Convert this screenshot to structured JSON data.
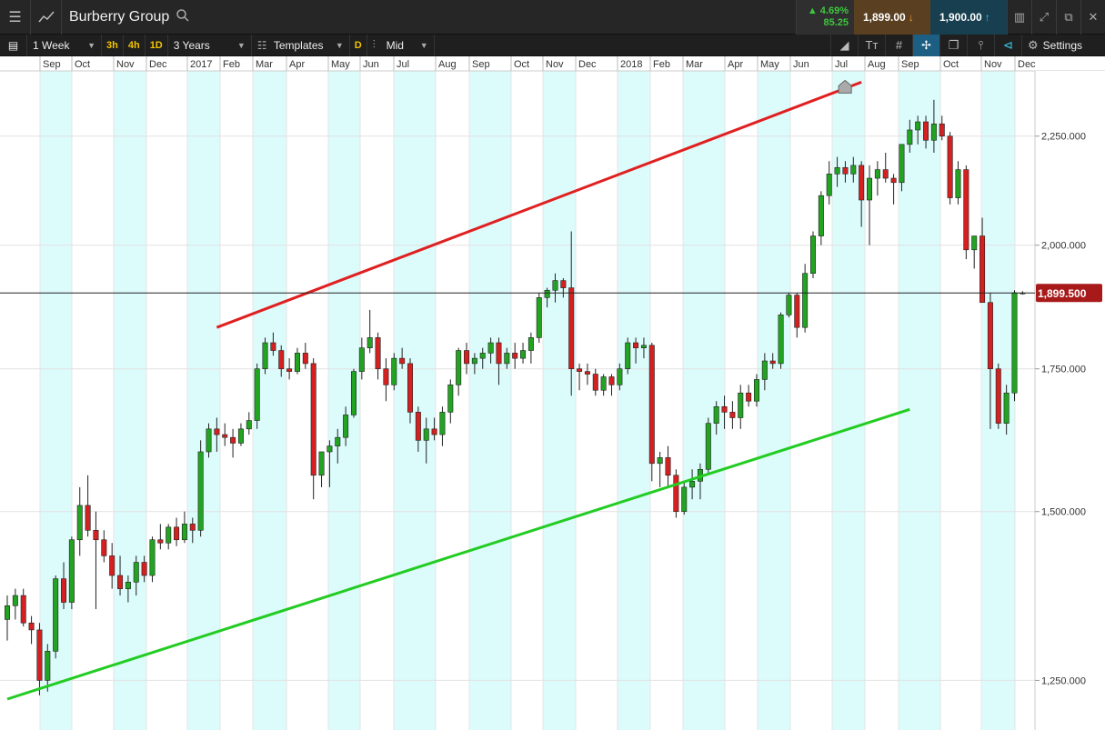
{
  "header": {
    "title": "Burberry Group",
    "change_pct": "▲ 4.69%",
    "change_abs": "85.25",
    "sell_price": "1,899.00",
    "buy_price": "1,900.00"
  },
  "toolbar": {
    "interval": "1 Week",
    "quick_intervals": [
      "3h",
      "4h",
      "1D"
    ],
    "range": "3 Years",
    "templates": "Templates",
    "d_badge": "D",
    "price_type": "Mid",
    "settings": "Settings"
  },
  "colors": {
    "up": "#22a322",
    "down": "#d42020",
    "resistance": "#e02020",
    "support": "#22cc22",
    "band": "#dcfbfb",
    "price_tag": "#a81a1a"
  },
  "chart_data": {
    "type": "candlestick",
    "x_labels": [
      "Sep",
      "Oct",
      "Nov",
      "Dec",
      "2017",
      "Feb",
      "Mar",
      "Apr",
      "May",
      "Jun",
      "Jul",
      "Aug",
      "Sep",
      "Oct",
      "Nov",
      "Dec",
      "2018",
      "Feb",
      "Mar",
      "Apr",
      "May",
      "Jun",
      "Jul",
      "Aug",
      "Sep",
      "Oct",
      "Nov",
      "Dec"
    ],
    "y_ticks": [
      "2,250.000",
      "2,000.000",
      "1,750.000",
      "1,500.000",
      "1,250.000"
    ],
    "y_tick_values": [
      2250,
      2000,
      1750,
      1500,
      1250
    ],
    "current_price": 1899.5,
    "current_price_label": "1,899.500",
    "ylim": [
      1200,
      2400
    ],
    "scale": "log",
    "trendlines": [
      {
        "name": "resistance",
        "from": [
          26,
          1830
        ],
        "to": [
          106,
          2385
        ]
      },
      {
        "name": "support",
        "from": [
          0,
          1225
        ],
        "to": [
          112,
          1675
        ]
      }
    ],
    "candles": [
      [
        1335,
        1370,
        1305,
        1355
      ],
      [
        1355,
        1380,
        1335,
        1370
      ],
      [
        1370,
        1380,
        1325,
        1330
      ],
      [
        1330,
        1340,
        1300,
        1320
      ],
      [
        1320,
        1330,
        1230,
        1250
      ],
      [
        1250,
        1300,
        1235,
        1290
      ],
      [
        1290,
        1400,
        1280,
        1395
      ],
      [
        1395,
        1420,
        1350,
        1360
      ],
      [
        1360,
        1460,
        1350,
        1455
      ],
      [
        1455,
        1540,
        1430,
        1510
      ],
      [
        1510,
        1560,
        1460,
        1470
      ],
      [
        1470,
        1500,
        1350,
        1455
      ],
      [
        1455,
        1470,
        1420,
        1430
      ],
      [
        1430,
        1450,
        1380,
        1400
      ],
      [
        1400,
        1430,
        1370,
        1380
      ],
      [
        1380,
        1400,
        1360,
        1390
      ],
      [
        1390,
        1430,
        1370,
        1420
      ],
      [
        1420,
        1430,
        1390,
        1400
      ],
      [
        1400,
        1460,
        1390,
        1455
      ],
      [
        1455,
        1480,
        1440,
        1450
      ],
      [
        1450,
        1480,
        1440,
        1475
      ],
      [
        1475,
        1490,
        1445,
        1455
      ],
      [
        1455,
        1500,
        1450,
        1480
      ],
      [
        1480,
        1490,
        1450,
        1470
      ],
      [
        1470,
        1620,
        1460,
        1600
      ],
      [
        1600,
        1650,
        1590,
        1640
      ],
      [
        1640,
        1660,
        1600,
        1630
      ],
      [
        1630,
        1650,
        1610,
        1625
      ],
      [
        1625,
        1640,
        1590,
        1615
      ],
      [
        1615,
        1650,
        1610,
        1640
      ],
      [
        1640,
        1670,
        1630,
        1655
      ],
      [
        1655,
        1760,
        1640,
        1750
      ],
      [
        1750,
        1810,
        1740,
        1800
      ],
      [
        1800,
        1820,
        1775,
        1785
      ],
      [
        1785,
        1795,
        1735,
        1750
      ],
      [
        1750,
        1770,
        1730,
        1745
      ],
      [
        1745,
        1790,
        1740,
        1780
      ],
      [
        1780,
        1800,
        1750,
        1760
      ],
      [
        1760,
        1770,
        1520,
        1560
      ],
      [
        1560,
        1600,
        1540,
        1600
      ],
      [
        1600,
        1620,
        1540,
        1610
      ],
      [
        1610,
        1640,
        1580,
        1625
      ],
      [
        1625,
        1680,
        1610,
        1665
      ],
      [
        1665,
        1750,
        1660,
        1745
      ],
      [
        1745,
        1810,
        1730,
        1790
      ],
      [
        1790,
        1865,
        1780,
        1810
      ],
      [
        1810,
        1820,
        1730,
        1750
      ],
      [
        1750,
        1770,
        1690,
        1720
      ],
      [
        1720,
        1780,
        1710,
        1770
      ],
      [
        1770,
        1790,
        1750,
        1760
      ],
      [
        1760,
        1770,
        1650,
        1670
      ],
      [
        1670,
        1680,
        1600,
        1620
      ],
      [
        1620,
        1660,
        1580,
        1640
      ],
      [
        1640,
        1660,
        1620,
        1630
      ],
      [
        1630,
        1680,
        1610,
        1670
      ],
      [
        1670,
        1730,
        1650,
        1720
      ],
      [
        1720,
        1790,
        1700,
        1785
      ],
      [
        1785,
        1800,
        1740,
        1760
      ],
      [
        1760,
        1780,
        1740,
        1770
      ],
      [
        1770,
        1790,
        1750,
        1780
      ],
      [
        1780,
        1810,
        1760,
        1800
      ],
      [
        1800,
        1810,
        1720,
        1760
      ],
      [
        1760,
        1790,
        1750,
        1780
      ],
      [
        1780,
        1800,
        1750,
        1770
      ],
      [
        1770,
        1800,
        1760,
        1785
      ],
      [
        1785,
        1820,
        1760,
        1810
      ],
      [
        1810,
        1900,
        1800,
        1890
      ],
      [
        1890,
        1910,
        1870,
        1905
      ],
      [
        1905,
        1940,
        1880,
        1925
      ],
      [
        1925,
        1930,
        1890,
        1910
      ],
      [
        1910,
        2030,
        1700,
        1750
      ],
      [
        1750,
        1760,
        1710,
        1745
      ],
      [
        1745,
        1760,
        1720,
        1740
      ],
      [
        1740,
        1750,
        1700,
        1710
      ],
      [
        1710,
        1740,
        1700,
        1735
      ],
      [
        1735,
        1740,
        1700,
        1720
      ],
      [
        1720,
        1760,
        1710,
        1750
      ],
      [
        1750,
        1810,
        1740,
        1800
      ],
      [
        1800,
        1810,
        1760,
        1790
      ],
      [
        1790,
        1810,
        1770,
        1795
      ],
      [
        1795,
        1800,
        1550,
        1580
      ],
      [
        1580,
        1600,
        1540,
        1590
      ],
      [
        1590,
        1610,
        1540,
        1560
      ],
      [
        1560,
        1570,
        1490,
        1500
      ],
      [
        1500,
        1550,
        1495,
        1540
      ],
      [
        1540,
        1570,
        1520,
        1550
      ],
      [
        1550,
        1580,
        1520,
        1570
      ],
      [
        1570,
        1660,
        1560,
        1650
      ],
      [
        1650,
        1690,
        1630,
        1680
      ],
      [
        1680,
        1700,
        1640,
        1670
      ],
      [
        1670,
        1690,
        1640,
        1660
      ],
      [
        1660,
        1720,
        1640,
        1705
      ],
      [
        1705,
        1720,
        1680,
        1690
      ],
      [
        1690,
        1740,
        1680,
        1730
      ],
      [
        1730,
        1780,
        1710,
        1765
      ],
      [
        1765,
        1780,
        1750,
        1760
      ],
      [
        1760,
        1860,
        1750,
        1855
      ],
      [
        1855,
        1900,
        1850,
        1895
      ],
      [
        1895,
        1900,
        1810,
        1830
      ],
      [
        1830,
        1960,
        1820,
        1940
      ],
      [
        1940,
        2030,
        1930,
        2020
      ],
      [
        2020,
        2120,
        2000,
        2110
      ],
      [
        2110,
        2190,
        2090,
        2160
      ],
      [
        2160,
        2200,
        2130,
        2175
      ],
      [
        2175,
        2190,
        2140,
        2160
      ],
      [
        2160,
        2200,
        2140,
        2180
      ],
      [
        2180,
        2190,
        2040,
        2100
      ],
      [
        2100,
        2180,
        2000,
        2150
      ],
      [
        2150,
        2190,
        2110,
        2170
      ],
      [
        2170,
        2210,
        2140,
        2150
      ],
      [
        2150,
        2160,
        2090,
        2140
      ],
      [
        2140,
        2230,
        2120,
        2230
      ],
      [
        2230,
        2290,
        2210,
        2265
      ],
      [
        2265,
        2300,
        2230,
        2285
      ],
      [
        2285,
        2300,
        2220,
        2240
      ],
      [
        2240,
        2340,
        2210,
        2280
      ],
      [
        2280,
        2300,
        2240,
        2250
      ],
      [
        2250,
        2260,
        2090,
        2105
      ],
      [
        2105,
        2190,
        2090,
        2170
      ],
      [
        2170,
        2180,
        1970,
        1990
      ],
      [
        1990,
        2020,
        1950,
        2020
      ],
      [
        2020,
        2060,
        1880,
        1880
      ],
      [
        1880,
        1900,
        1640,
        1750
      ],
      [
        1750,
        1760,
        1640,
        1650
      ],
      [
        1650,
        1720,
        1630,
        1705
      ],
      [
        1705,
        1905,
        1690,
        1900
      ],
      [
        1899,
        1903,
        1896,
        1899.5
      ]
    ]
  }
}
